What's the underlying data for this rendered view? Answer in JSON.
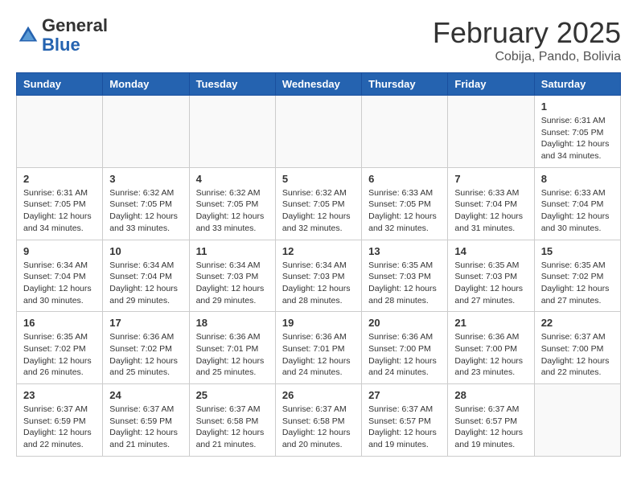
{
  "header": {
    "logo_general": "General",
    "logo_blue": "Blue",
    "month_title": "February 2025",
    "location": "Cobija, Pando, Bolivia"
  },
  "weekdays": [
    "Sunday",
    "Monday",
    "Tuesday",
    "Wednesday",
    "Thursday",
    "Friday",
    "Saturday"
  ],
  "weeks": [
    [
      {
        "day": "",
        "info": ""
      },
      {
        "day": "",
        "info": ""
      },
      {
        "day": "",
        "info": ""
      },
      {
        "day": "",
        "info": ""
      },
      {
        "day": "",
        "info": ""
      },
      {
        "day": "",
        "info": ""
      },
      {
        "day": "1",
        "info": "Sunrise: 6:31 AM\nSunset: 7:05 PM\nDaylight: 12 hours\nand 34 minutes."
      }
    ],
    [
      {
        "day": "2",
        "info": "Sunrise: 6:31 AM\nSunset: 7:05 PM\nDaylight: 12 hours\nand 34 minutes."
      },
      {
        "day": "3",
        "info": "Sunrise: 6:32 AM\nSunset: 7:05 PM\nDaylight: 12 hours\nand 33 minutes."
      },
      {
        "day": "4",
        "info": "Sunrise: 6:32 AM\nSunset: 7:05 PM\nDaylight: 12 hours\nand 33 minutes."
      },
      {
        "day": "5",
        "info": "Sunrise: 6:32 AM\nSunset: 7:05 PM\nDaylight: 12 hours\nand 32 minutes."
      },
      {
        "day": "6",
        "info": "Sunrise: 6:33 AM\nSunset: 7:05 PM\nDaylight: 12 hours\nand 32 minutes."
      },
      {
        "day": "7",
        "info": "Sunrise: 6:33 AM\nSunset: 7:04 PM\nDaylight: 12 hours\nand 31 minutes."
      },
      {
        "day": "8",
        "info": "Sunrise: 6:33 AM\nSunset: 7:04 PM\nDaylight: 12 hours\nand 30 minutes."
      }
    ],
    [
      {
        "day": "9",
        "info": "Sunrise: 6:34 AM\nSunset: 7:04 PM\nDaylight: 12 hours\nand 30 minutes."
      },
      {
        "day": "10",
        "info": "Sunrise: 6:34 AM\nSunset: 7:04 PM\nDaylight: 12 hours\nand 29 minutes."
      },
      {
        "day": "11",
        "info": "Sunrise: 6:34 AM\nSunset: 7:03 PM\nDaylight: 12 hours\nand 29 minutes."
      },
      {
        "day": "12",
        "info": "Sunrise: 6:34 AM\nSunset: 7:03 PM\nDaylight: 12 hours\nand 28 minutes."
      },
      {
        "day": "13",
        "info": "Sunrise: 6:35 AM\nSunset: 7:03 PM\nDaylight: 12 hours\nand 28 minutes."
      },
      {
        "day": "14",
        "info": "Sunrise: 6:35 AM\nSunset: 7:03 PM\nDaylight: 12 hours\nand 27 minutes."
      },
      {
        "day": "15",
        "info": "Sunrise: 6:35 AM\nSunset: 7:02 PM\nDaylight: 12 hours\nand 27 minutes."
      }
    ],
    [
      {
        "day": "16",
        "info": "Sunrise: 6:35 AM\nSunset: 7:02 PM\nDaylight: 12 hours\nand 26 minutes."
      },
      {
        "day": "17",
        "info": "Sunrise: 6:36 AM\nSunset: 7:02 PM\nDaylight: 12 hours\nand 25 minutes."
      },
      {
        "day": "18",
        "info": "Sunrise: 6:36 AM\nSunset: 7:01 PM\nDaylight: 12 hours\nand 25 minutes."
      },
      {
        "day": "19",
        "info": "Sunrise: 6:36 AM\nSunset: 7:01 PM\nDaylight: 12 hours\nand 24 minutes."
      },
      {
        "day": "20",
        "info": "Sunrise: 6:36 AM\nSunset: 7:00 PM\nDaylight: 12 hours\nand 24 minutes."
      },
      {
        "day": "21",
        "info": "Sunrise: 6:36 AM\nSunset: 7:00 PM\nDaylight: 12 hours\nand 23 minutes."
      },
      {
        "day": "22",
        "info": "Sunrise: 6:37 AM\nSunset: 7:00 PM\nDaylight: 12 hours\nand 22 minutes."
      }
    ],
    [
      {
        "day": "23",
        "info": "Sunrise: 6:37 AM\nSunset: 6:59 PM\nDaylight: 12 hours\nand 22 minutes."
      },
      {
        "day": "24",
        "info": "Sunrise: 6:37 AM\nSunset: 6:59 PM\nDaylight: 12 hours\nand 21 minutes."
      },
      {
        "day": "25",
        "info": "Sunrise: 6:37 AM\nSunset: 6:58 PM\nDaylight: 12 hours\nand 21 minutes."
      },
      {
        "day": "26",
        "info": "Sunrise: 6:37 AM\nSunset: 6:58 PM\nDaylight: 12 hours\nand 20 minutes."
      },
      {
        "day": "27",
        "info": "Sunrise: 6:37 AM\nSunset: 6:57 PM\nDaylight: 12 hours\nand 19 minutes."
      },
      {
        "day": "28",
        "info": "Sunrise: 6:37 AM\nSunset: 6:57 PM\nDaylight: 12 hours\nand 19 minutes."
      },
      {
        "day": "",
        "info": ""
      }
    ]
  ]
}
